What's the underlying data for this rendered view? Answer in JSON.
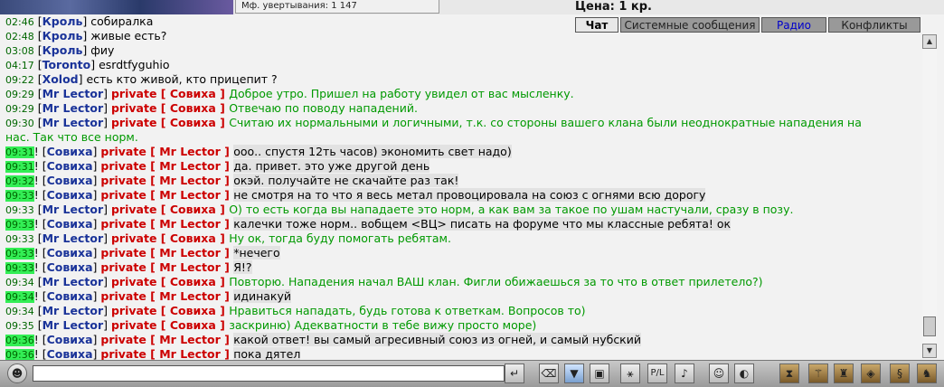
{
  "header": {
    "mf_label": "Мф. увертывания: 1 147",
    "price_label": "Цена: 1 кр."
  },
  "tabs": [
    "Чат",
    "Системные сообщения",
    "Радио",
    "Конфликты"
  ],
  "messages": [
    {
      "time": "02:46",
      "excl": false,
      "nick": "Кроль",
      "private": false,
      "to": "",
      "text": "собиралка",
      "style": "plain"
    },
    {
      "time": "02:48",
      "excl": false,
      "nick": "Кроль",
      "private": false,
      "to": "",
      "text": "живые есть?",
      "style": "plain"
    },
    {
      "time": "03:08",
      "excl": false,
      "nick": "Кроль",
      "private": false,
      "to": "",
      "text": "фиу",
      "style": "plain"
    },
    {
      "time": "04:17",
      "excl": false,
      "nick": "Toronto",
      "private": false,
      "to": "",
      "text": "esrdtfyguhio",
      "style": "plain"
    },
    {
      "time": "09:22",
      "excl": false,
      "nick": "Xolod",
      "private": false,
      "to": "",
      "text": "есть кто живой, кто прицепит ?",
      "style": "plain"
    },
    {
      "time": "09:29",
      "excl": false,
      "nick": "Mr Lector",
      "private": true,
      "to": "Совиха",
      "text": "Доброе утро. Пришел на работу увидел от вас мысленку.",
      "style": "green"
    },
    {
      "time": "09:29",
      "excl": false,
      "nick": "Mr Lector",
      "private": true,
      "to": "Совиха",
      "text": "Отвечаю по поводу нападений.",
      "style": "green"
    },
    {
      "time": "09:30",
      "excl": false,
      "nick": "Mr Lector",
      "private": true,
      "to": "Совиха",
      "text": "Считаю их нормальными и логичными, т.к. со стороны вашего клана были неоднократные нападения на",
      "style": "green"
    },
    {
      "time": "",
      "excl": false,
      "nick": "",
      "private": false,
      "to": "",
      "text": "нас. Так что все норм.",
      "style": "green"
    },
    {
      "time": "09:31",
      "excl": true,
      "nick": "Совиха",
      "private": true,
      "to": "Mr Lector",
      "text": "ооо.. спустя 12ть часов) экономить свет надо)",
      "style": "black"
    },
    {
      "time": "09:31",
      "excl": true,
      "nick": "Совиха",
      "private": true,
      "to": "Mr Lector",
      "text": "да. привет. это уже другой день",
      "style": "black"
    },
    {
      "time": "09:32",
      "excl": true,
      "nick": "Совиха",
      "private": true,
      "to": "Mr Lector",
      "text": "окэй. получайте не скачайте раз так!",
      "style": "black"
    },
    {
      "time": "09:33",
      "excl": true,
      "nick": "Совиха",
      "private": true,
      "to": "Mr Lector",
      "text": "не смотря на то что я весь метал провоцировала на союз с огнями всю дорогу",
      "style": "black"
    },
    {
      "time": "09:33",
      "excl": false,
      "nick": "Mr Lector",
      "private": true,
      "to": "Совиха",
      "text": "О) то есть когда вы нападаете это норм, а как вам за такое по ушам настучали, сразу в позу.",
      "style": "green"
    },
    {
      "time": "09:33",
      "excl": true,
      "nick": "Совиха",
      "private": true,
      "to": "Mr Lector",
      "text": "калечки тоже норм.. вобщем <ВЦ> писать на форуме что мы классные ребята! ок",
      "style": "black"
    },
    {
      "time": "09:33",
      "excl": false,
      "nick": "Mr Lector",
      "private": true,
      "to": "Совиха",
      "text": "Ну ок, тогда буду помогать ребятам.",
      "style": "green"
    },
    {
      "time": "09:33",
      "excl": true,
      "nick": "Совиха",
      "private": true,
      "to": "Mr Lector",
      "text": "*нечего",
      "style": "black"
    },
    {
      "time": "09:33",
      "excl": true,
      "nick": "Совиха",
      "private": true,
      "to": "Mr Lector",
      "text": "Я!?",
      "style": "black"
    },
    {
      "time": "09:34",
      "excl": false,
      "nick": "Mr Lector",
      "private": true,
      "to": "Совиха",
      "text": "Повторю. Нападения начал ВАШ клан. Фигли обижаешься за то что в ответ прилетело?)",
      "style": "green"
    },
    {
      "time": "09:34",
      "excl": true,
      "nick": "Совиха",
      "private": true,
      "to": "Mr Lector",
      "text": "идинакуй",
      "style": "black"
    },
    {
      "time": "09:34",
      "excl": false,
      "nick": "Mr Lector",
      "private": true,
      "to": "Совиха",
      "text": "Нравиться нападать, будь готова к ответкам. Вопросов то)",
      "style": "green"
    },
    {
      "time": "09:35",
      "excl": false,
      "nick": "Mr Lector",
      "private": true,
      "to": "Совиха",
      "text": "заскриню) Адекватности в тебе вижу просто море)",
      "style": "green"
    },
    {
      "time": "09:36",
      "excl": true,
      "nick": "Совиха",
      "private": true,
      "to": "Mr Lector",
      "text": "какой ответ! вы самый агресивный союз из огней, и самый нубский",
      "style": "black"
    },
    {
      "time": "09:36",
      "excl": true,
      "nick": "Совиха",
      "private": true,
      "to": "Mr Lector",
      "text": "пока дятел",
      "style": "black"
    }
  ],
  "private_word": "private",
  "input": {
    "value": ""
  },
  "toolbar_icons": {
    "left": [
      "smile-face-icon"
    ],
    "right": [
      "enter-icon",
      "eraser-icon",
      "filter-icon",
      "save-icon",
      "dance-icon",
      "pl-icon",
      "music-icon",
      "smiley-icon",
      "helmet-icon",
      "hourglass-icon",
      "magic-wand-icon",
      "bag-icon",
      "treasure-icon",
      "scroll-icon",
      "armor-icon"
    ]
  }
}
